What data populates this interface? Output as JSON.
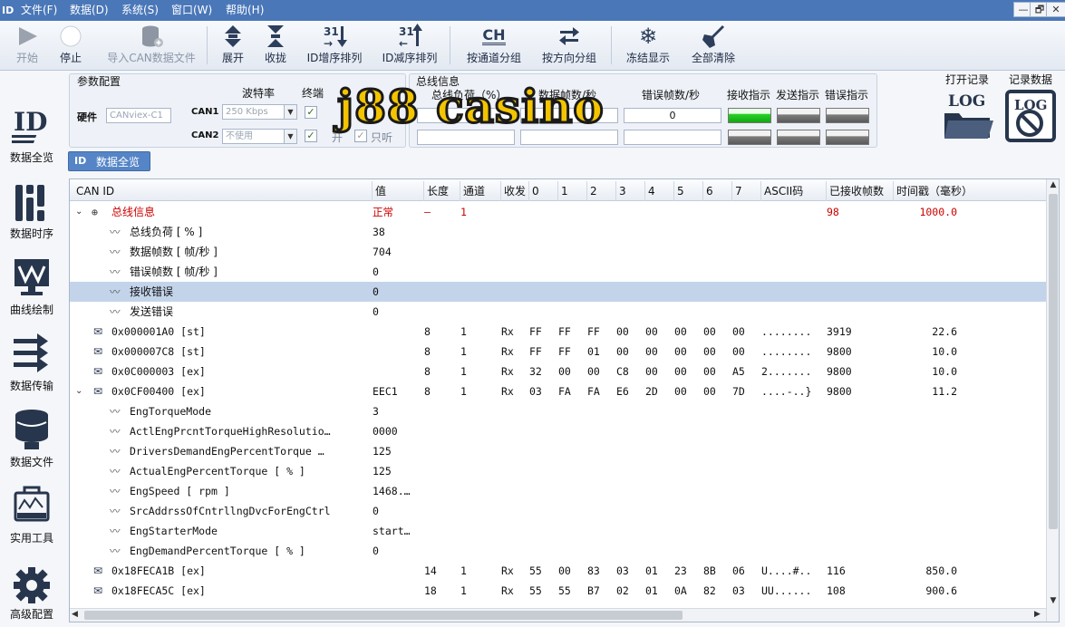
{
  "menubar": {
    "logo": "ID",
    "items": [
      "文件(F)",
      "数据(D)",
      "系统(S)",
      "窗口(W)",
      "帮助(H)"
    ],
    "window_buttons": [
      "—",
      "🗗",
      "✕"
    ]
  },
  "toolbar": {
    "start": "开始",
    "stop": "停止",
    "import": "导入CAN数据文件",
    "expand": "展开",
    "collapse": "收拢",
    "id_asc": "ID增序排列",
    "id_desc": "ID减序排列",
    "by_channel": "按通道分组",
    "by_direction": "按方向分组",
    "freeze": "冻结显示",
    "clear_all": "全部清除",
    "ch_icon_text": "CH"
  },
  "sidebar": {
    "items": [
      "数据全览",
      "数据时序",
      "曲线绘制",
      "数据传输",
      "数据文件",
      "实用工具",
      "高级配置"
    ]
  },
  "params": {
    "title": "参数配置",
    "baud_label": "波特率",
    "terminal_label": "终端",
    "hardware_label": "硬件",
    "hardware_value": "CANviex-C1",
    "can1_label": "CAN1",
    "can1_baud": "250 Kbps",
    "can2_label": "CAN2",
    "can2_baud": "不使用",
    "open_label": "开",
    "readonly_label": "只听"
  },
  "businfo": {
    "title": "总线信息",
    "load_label": "总线负荷（%）",
    "fps_label": "数据帧数/秒",
    "err_label": "错误帧数/秒",
    "rx_ind": "接收指示",
    "tx_ind": "发送指示",
    "err_ind": "错误指示",
    "err_value": "0"
  },
  "records": {
    "open_log": "打开记录",
    "rec_data": "记录数据",
    "log_text": "LOG"
  },
  "tab": {
    "label": "数据全览"
  },
  "grid": {
    "headers": [
      "CAN ID",
      "值",
      "长度",
      "通道",
      "收发",
      "0",
      "1",
      "2",
      "3",
      "4",
      "5",
      "6",
      "7",
      "ASCII码",
      "已接收帧数",
      "时间戳（毫秒）"
    ],
    "rows": [
      {
        "kind": "group",
        "red": true,
        "id": "总线信息",
        "val": "正常",
        "len": "–",
        "ch": "1",
        "dir": "",
        "bytes": [
          "",
          "",
          "",
          "",
          "",
          "",
          "",
          ""
        ],
        "ascii": "",
        "count": "98",
        "ts": "1000.0"
      },
      {
        "kind": "sub",
        "id": "总线负荷  [ % ]",
        "val": "38"
      },
      {
        "kind": "sub",
        "id": "数据帧数  [ 帧/秒 ]",
        "val": "704"
      },
      {
        "kind": "sub",
        "id": "错误帧数  [ 帧/秒 ]",
        "val": "0"
      },
      {
        "kind": "sub",
        "sel": true,
        "id": "接收错误",
        "val": "0"
      },
      {
        "kind": "sub",
        "id": "发送错误",
        "val": "0"
      },
      {
        "kind": "msg",
        "id": "0x000001A0 [st]",
        "val": "",
        "len": "8",
        "ch": "1",
        "dir": "Rx",
        "bytes": [
          "FF",
          "FF",
          "FF",
          "00",
          "00",
          "00",
          "00",
          "00"
        ],
        "ascii": "........",
        "count": "3919",
        "ts": "22.6"
      },
      {
        "kind": "msg",
        "id": "0x000007C8 [st]",
        "val": "",
        "len": "8",
        "ch": "1",
        "dir": "Rx",
        "bytes": [
          "FF",
          "FF",
          "01",
          "00",
          "00",
          "00",
          "00",
          "00"
        ],
        "ascii": "........",
        "count": "9800",
        "ts": "10.0"
      },
      {
        "kind": "msg",
        "id": "0x0C000003 [ex]",
        "val": "",
        "len": "8",
        "ch": "1",
        "dir": "Rx",
        "bytes": [
          "32",
          "00",
          "00",
          "C8",
          "00",
          "00",
          "00",
          "A5"
        ],
        "ascii": "2.......",
        "count": "9800",
        "ts": "10.0"
      },
      {
        "kind": "msgx",
        "id": "0x0CF00400 [ex]",
        "val": "EEC1",
        "len": "8",
        "ch": "1",
        "dir": "Rx",
        "bytes": [
          "03",
          "FA",
          "FA",
          "E6",
          "2D",
          "00",
          "00",
          "7D"
        ],
        "ascii": "....-..}",
        "count": "9800",
        "ts": "11.2"
      },
      {
        "kind": "sig",
        "id": "EngTorqueMode",
        "val": "3"
      },
      {
        "kind": "sig",
        "id": "ActlEngPrcntTorqueHighResolutio…",
        "val": "0000"
      },
      {
        "kind": "sig",
        "id": "DriversDemandEngPercentTorque  …",
        "val": "125"
      },
      {
        "kind": "sig",
        "id": "ActualEngPercentTorque  [ % ]",
        "val": "125"
      },
      {
        "kind": "sig",
        "id": "EngSpeed  [ rpm ]",
        "val": "1468.…"
      },
      {
        "kind": "sig",
        "id": "SrcAddrssOfCntrllngDvcForEngCtrl",
        "val": "0"
      },
      {
        "kind": "sig",
        "id": "EngStarterMode",
        "val": "start…"
      },
      {
        "kind": "sig",
        "id": "EngDemandPercentTorque  [ % ]",
        "val": "0"
      },
      {
        "kind": "msg",
        "id": "0x18FECA1B [ex]",
        "val": "",
        "len": "14",
        "ch": "1",
        "dir": "Rx",
        "bytes": [
          "55",
          "00",
          "83",
          "03",
          "01",
          "23",
          "8B",
          "06"
        ],
        "ascii": "U....#..",
        "count": "116",
        "ts": "850.0"
      },
      {
        "kind": "msg",
        "id": "0x18FECA5C [ex]",
        "val": "",
        "len": "18",
        "ch": "1",
        "dir": "Rx",
        "bytes": [
          "55",
          "55",
          "B7",
          "02",
          "01",
          "0A",
          "82",
          "03"
        ],
        "ascii": "UU......",
        "count": "108",
        "ts": "900.6"
      }
    ]
  },
  "watermark": {
    "text": "j88 casino"
  },
  "colors": {
    "menubar": "#4a77b8",
    "selected_row": "#c3d4ea",
    "led_on": "#1ec01e",
    "watermark": "#f3c400",
    "red_text": "#cc0000"
  }
}
